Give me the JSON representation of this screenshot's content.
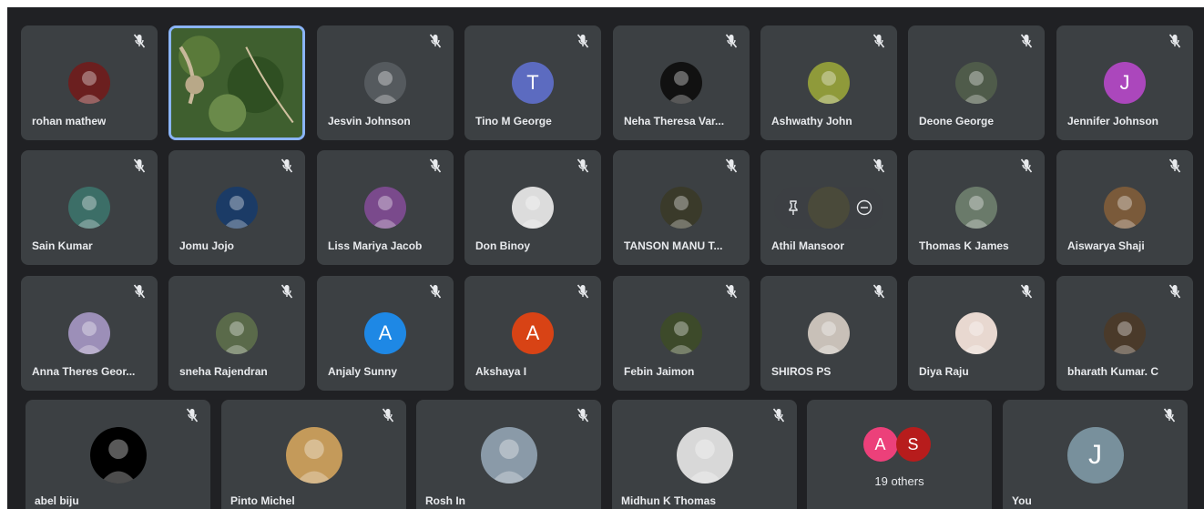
{
  "participants_row1": [
    {
      "name": "rohan mathew",
      "avatar": "photo",
      "color": "#6b1f1f"
    },
    {
      "name": "",
      "avatar": "screen-share-map",
      "color": "#2d5a2a"
    },
    {
      "name": "Jesvin Johnson",
      "avatar": "photo",
      "color": "#555a5e"
    },
    {
      "name": "Tino M George",
      "avatar": "letter",
      "letter": "T",
      "color": "#5c6bc0"
    },
    {
      "name": "Neha Theresa Var...",
      "avatar": "photo",
      "color": "#111111"
    },
    {
      "name": "Ashwathy John",
      "avatar": "photo",
      "color": "#8f9a3a"
    },
    {
      "name": "Deone George",
      "avatar": "photo",
      "color": "#4f5b4a"
    },
    {
      "name": "Jennifer Johnson",
      "avatar": "letter",
      "letter": "J",
      "color": "#ab47bc"
    }
  ],
  "participants_row2": [
    {
      "name": "Sain Kumar",
      "avatar": "photo",
      "color": "#3c6e67"
    },
    {
      "name": "Jomu Jojo",
      "avatar": "photo",
      "color": "#1b3b66"
    },
    {
      "name": "Liss Mariya Jacob",
      "avatar": "photo",
      "color": "#7a4a8c"
    },
    {
      "name": "Don Binoy",
      "avatar": "photo",
      "color": "#dcdcdc"
    },
    {
      "name": "TANSON MANU T...",
      "avatar": "photo",
      "color": "#3a3a2a"
    },
    {
      "name": "Athil Mansoor",
      "avatar": "photo",
      "color": "#4a4a3a",
      "hovered": true
    },
    {
      "name": "Thomas K James",
      "avatar": "photo",
      "color": "#6a7a6a"
    },
    {
      "name": "Aiswarya Shaji",
      "avatar": "photo",
      "color": "#7a5a3a"
    }
  ],
  "participants_row3": [
    {
      "name": "Anna Theres Geor...",
      "avatar": "photo",
      "color": "#9c8fb8"
    },
    {
      "name": "sneha Rajendran",
      "avatar": "photo",
      "color": "#5a6a4a"
    },
    {
      "name": "Anjaly Sunny",
      "avatar": "letter",
      "letter": "A",
      "color": "#1e88e5"
    },
    {
      "name": "Akshaya I",
      "avatar": "letter",
      "letter": "A",
      "color": "#d84315"
    },
    {
      "name": "Febin Jaimon",
      "avatar": "photo",
      "color": "#3d4a2a"
    },
    {
      "name": "SHIROS PS",
      "avatar": "photo",
      "color": "#c8c0b8"
    },
    {
      "name": "Diya Raju",
      "avatar": "photo",
      "color": "#e8d8d0"
    },
    {
      "name": "bharath Kumar. C",
      "avatar": "photo",
      "color": "#4a3a2a"
    }
  ],
  "participants_row4": [
    {
      "name": "abel biju",
      "avatar": "photo",
      "color": "#000000",
      "muted": true
    },
    {
      "name": "Pinto Michel",
      "avatar": "photo",
      "color": "#c49a5a",
      "muted": true
    },
    {
      "name": "Rosh In",
      "avatar": "photo",
      "color": "#8a9aa8",
      "muted": true
    },
    {
      "name": "Midhun K Thomas",
      "avatar": "photo",
      "color": "#d8d8d8",
      "muted": true
    },
    {
      "name": "others",
      "avatar": "others",
      "muted": false
    },
    {
      "name": "You",
      "avatar": "letter",
      "letter": "J",
      "color": "#78909c",
      "muted": true
    }
  ],
  "others": {
    "label": "19 others",
    "letters": [
      "A",
      "S"
    ],
    "colors": [
      "#ec407a",
      "#b71c1c"
    ]
  }
}
